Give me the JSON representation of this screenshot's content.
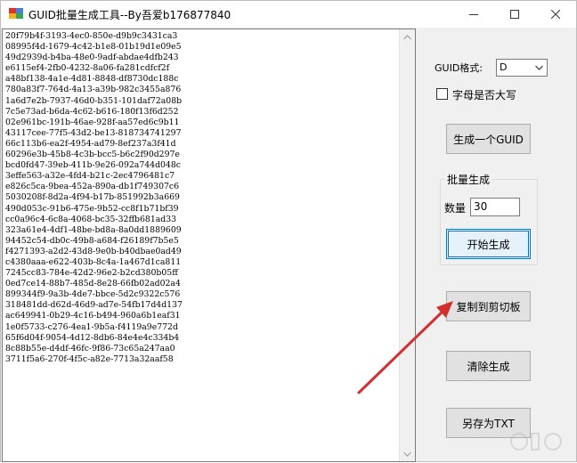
{
  "window": {
    "title": "GUID批量生成工具--By吾爱b176877840"
  },
  "output": {
    "lines": [
      "20f79b4f-3193-4ec0-850e-d9b9c3431ca3",
      "08995f4d-1679-4c42-b1e8-01b19d1e09e5",
      "49d2939d-b4ba-48e0-9adf-abdae4dfb243",
      "e6115ef4-2fb0-4232-8a06-fa281cdfcf2f",
      "a48bf138-4a1e-4d81-8848-df8730dc188c",
      "780a83f7-764d-4a13-a39b-982c3455a876",
      "1a6d7e2b-7937-46d0-b351-101daf72a08b",
      "7c5e73ad-b6da-4c62-b616-180f13f6d252",
      "02e961bc-191b-46ae-928f-aa57ed6c9b11",
      "43117cee-77f5-43d2-be13-818734741297",
      "66c113b6-ea2f-4954-ad79-8ef237a3f41d",
      "60296e3b-45b8-4c3b-bcc5-b6c2f90d297e",
      "bcd0fd47-39eb-411b-9e26-092a744d048c",
      "3effe563-a32e-4fd4-b21c-2ec4796481c7",
      "e826c5ca-9bea-452a-890a-db1f749307c6",
      "5030208f-8d2a-4f94-b17b-851992b3a669",
      "490d053c-91b6-475e-9b52-cc8f1b71bf39",
      "cc0a96c4-6c8a-4068-bc35-32ffb681ad33",
      "323a61e4-4df1-48be-bd8a-8a0dd1889609",
      "94452c54-db0c-49b8-a684-f26189f7b5e5",
      "f4271393-a2d2-43d8-9e0b-b40dbae0ad49",
      "c4380aaa-e622-403b-8c4a-1a467d1ca811",
      "7245cc83-784e-42d2-96e2-b2cd380b05ff",
      "0ed7ce14-88b7-485d-8e28-66fb02ad02a4",
      "899344f9-9a3b-4de7-bbce-5d2c9322c576",
      "318481dd-d62d-46d9-ad7e-54fb17d4d137",
      "ac649941-0b29-4c16-b494-960a6b1eaf31",
      "1e0f5733-c276-4ea1-9b5a-f4119a9e772d",
      "65f6d04f-9054-4d12-8db6-84e4e4c334b4",
      "8c88b55e-d4df-46fc-9f86-73c65a247aa0",
      "3711f5a6-270f-4f5c-a82e-7713a32aaf58"
    ]
  },
  "controls": {
    "format_label": "GUID格式:",
    "format_value": "D",
    "uppercase_label": "字母是否大写",
    "uppercase_checked": false,
    "generate_one_label": "生成一个GUID",
    "batch_group_label": "批量生成",
    "quantity_label": "数量",
    "quantity_value": "30",
    "start_label": "开始生成",
    "copy_label": "复制到剪切板",
    "clear_label": "清除生成",
    "save_label": "另存为TXT"
  },
  "colors": {
    "arrow": "#d32f2f",
    "focus_border": "#0078d7"
  },
  "icons": {
    "minimize": "minimize-icon",
    "maximize": "maximize-icon",
    "close": "close-icon",
    "dropdown": "chevron-down-icon",
    "annotation": "red-arrow-icon"
  }
}
